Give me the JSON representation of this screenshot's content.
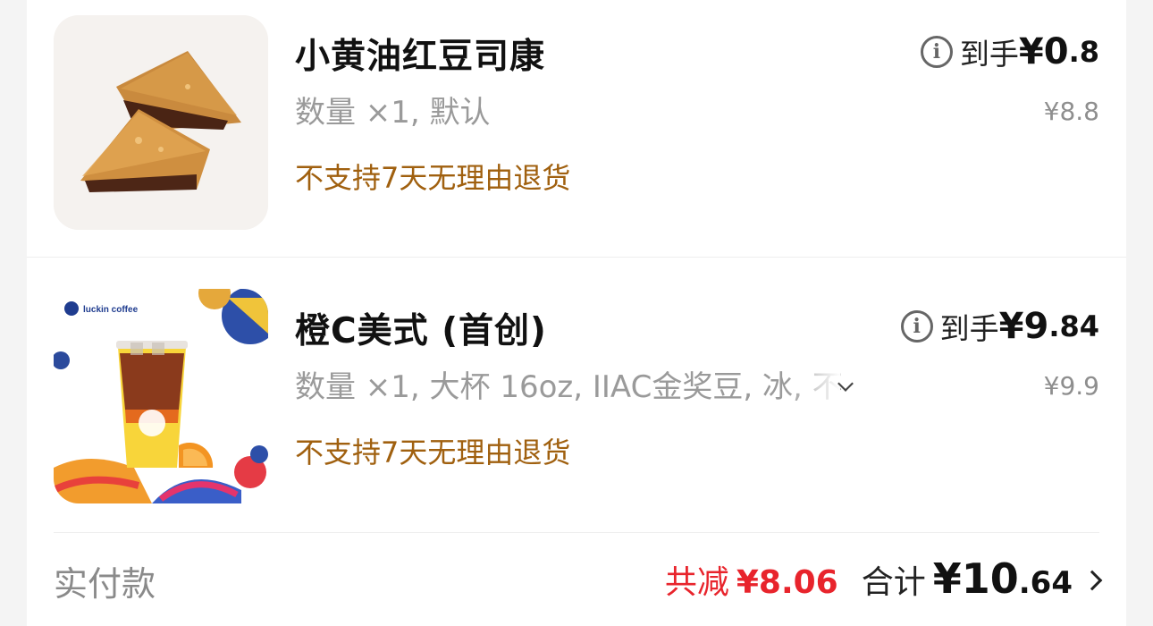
{
  "items": [
    {
      "title": "小黄油红豆司康",
      "spec": "数量 ×1, 默认",
      "policy": "不支持7天无理由退货",
      "net_label": "到手",
      "net_int": "¥0",
      "net_dec": ".8",
      "original": "¥8.8"
    },
    {
      "title": "橙C美式 (首创)",
      "spec": "数量 ×1, 大杯 16oz, IIAC金奖豆, 冰, 不",
      "policy": "不支持7天无理由退货",
      "net_label": "到手",
      "net_int": "¥9",
      "net_dec": ".84",
      "original": "¥9.9",
      "brand": "luckin coffee"
    }
  ],
  "footer": {
    "pay_label": "实付款",
    "discount_label": "共减",
    "discount_value": "¥8.06",
    "total_label": "合计",
    "total_int": "¥10",
    "total_dec": ".64"
  },
  "colors": {
    "policy": "#a0600f",
    "discount": "#e8242c"
  },
  "icons": [
    "info-icon",
    "chevron-down-icon",
    "chevron-right-icon"
  ]
}
